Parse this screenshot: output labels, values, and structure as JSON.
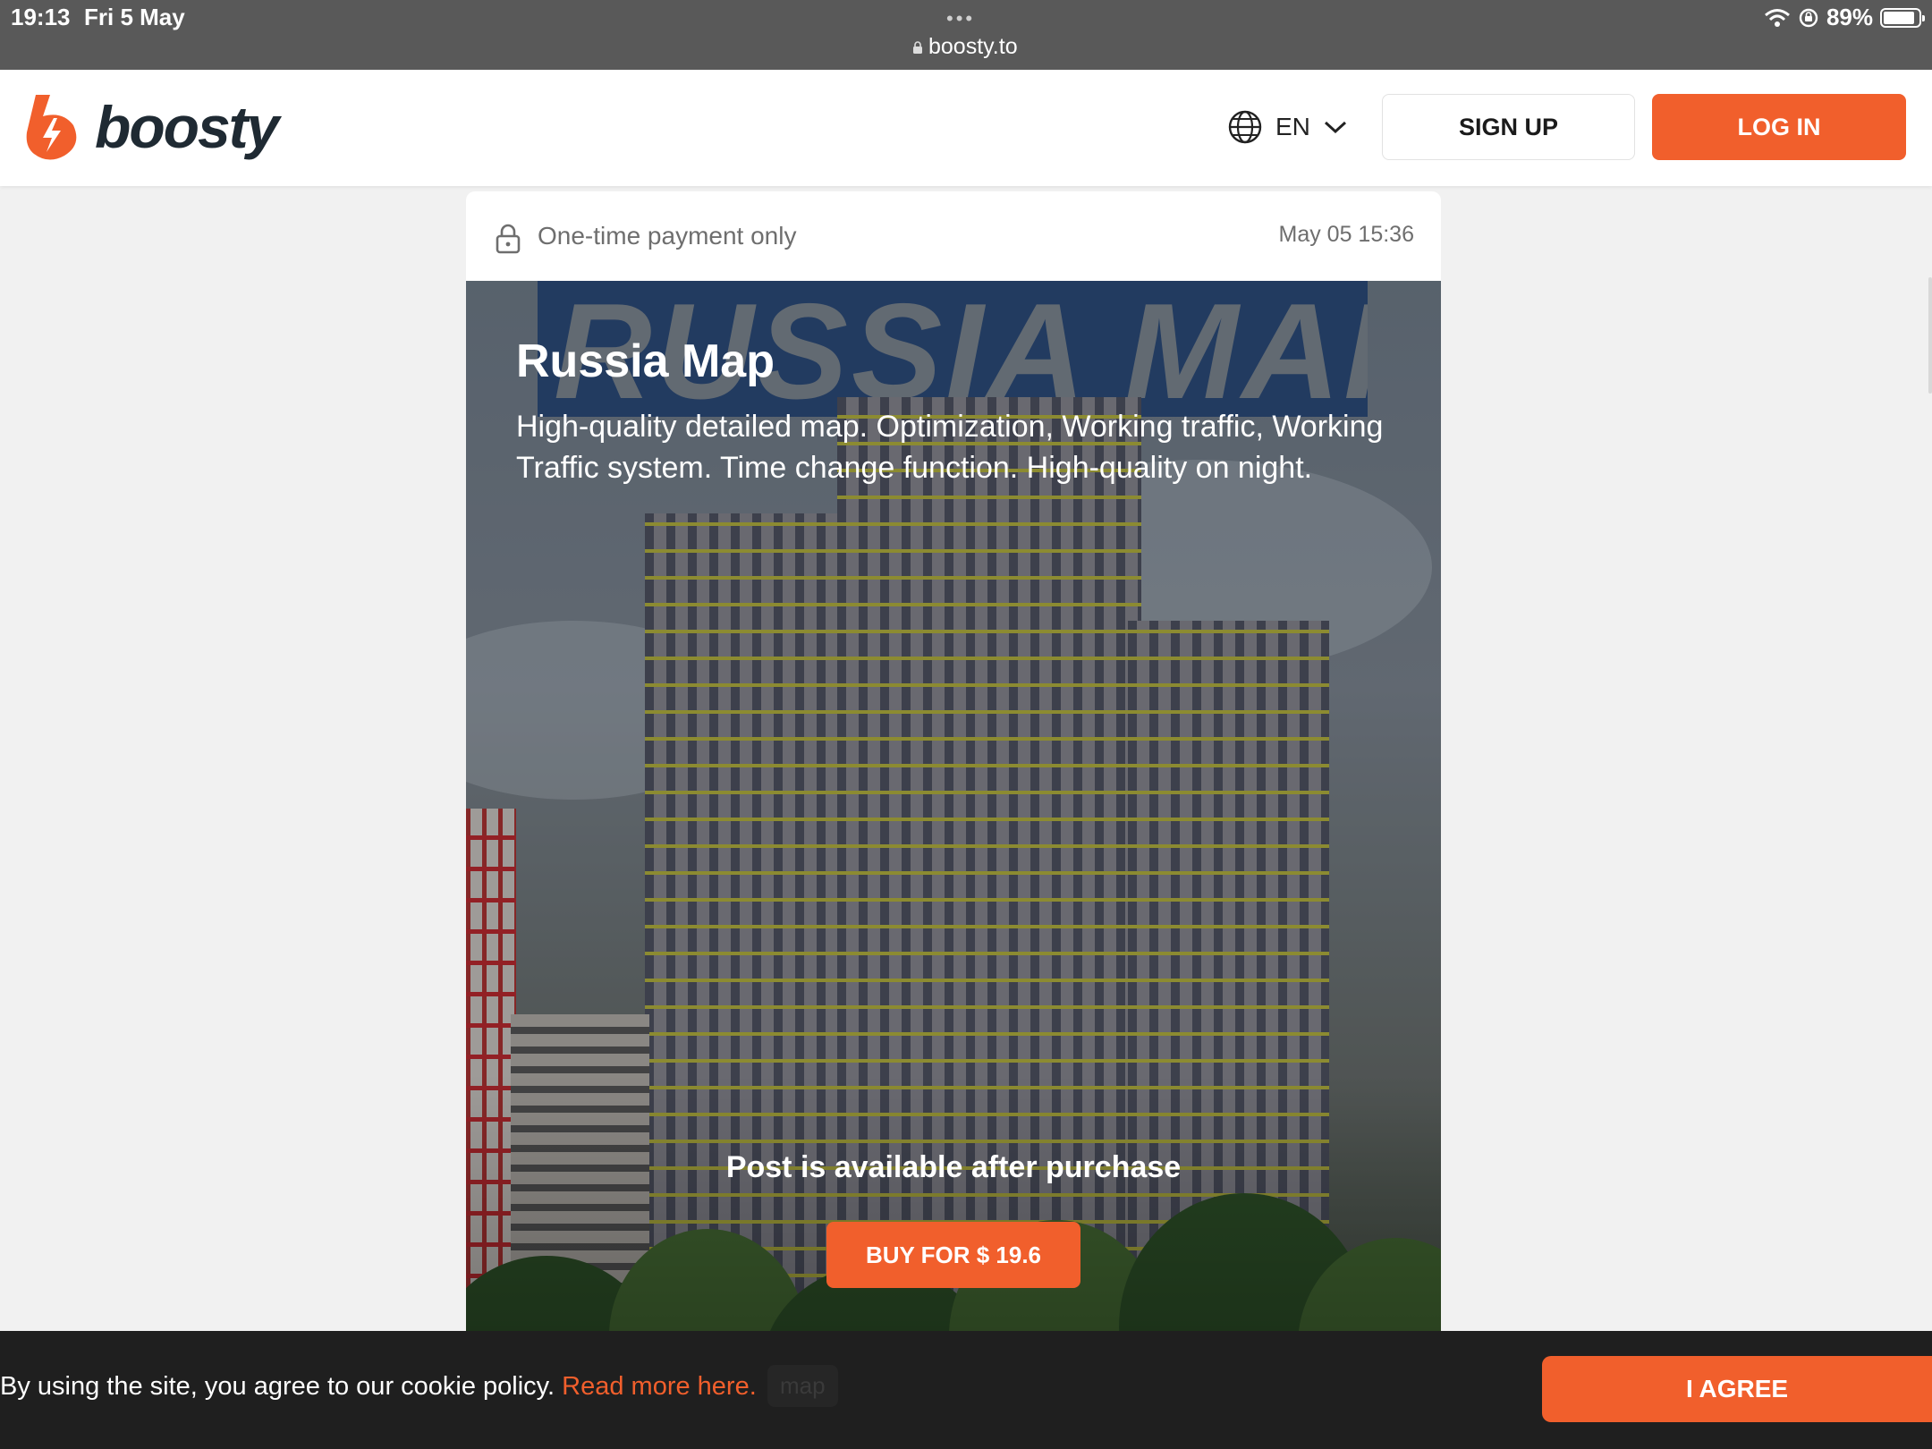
{
  "status_bar": {
    "time": "19:13",
    "date": "Fri 5 May",
    "dots": "•••",
    "url": "boosty.to",
    "battery": "89%",
    "battery_level": 0.89
  },
  "header": {
    "logo_text": "boosty",
    "language": "EN",
    "signup_label": "SIGN UP",
    "login_label": "LOG IN"
  },
  "post": {
    "access_label": "One-time payment only",
    "date": "May 05 15:36",
    "banner_text": "RUSSIA MAP",
    "title": "Russia Map",
    "description": "High-quality detailed map. Optimization, Working traffic, Working Traffic system. Time change function. High-quality on night.",
    "locked_message": "Post is available after purchase",
    "buy_label": "BUY FOR $ 19.6"
  },
  "cookie_bar": {
    "message": "By using the site, you agree to our cookie policy. ",
    "link": "Read more here.",
    "tag": "map",
    "agree_label": "I AGREE"
  },
  "colors": {
    "accent": "#f15f2c",
    "status_bar": "#595959",
    "cookie_bar": "#1f1f1f"
  }
}
